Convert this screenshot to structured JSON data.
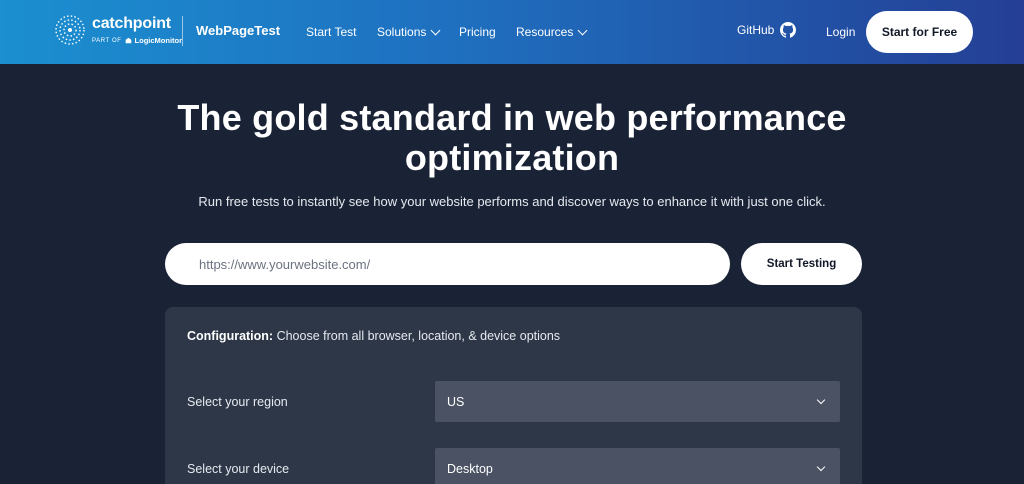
{
  "header": {
    "brand_name": "catchpoint",
    "brand_sub_prefix": "PART OF",
    "brand_sub_company": "LogicMonitor",
    "product": "WebPageTest",
    "nav": [
      {
        "label": "Start Test",
        "has_dropdown": false
      },
      {
        "label": "Solutions",
        "has_dropdown": true
      },
      {
        "label": "Pricing",
        "has_dropdown": false
      },
      {
        "label": "Resources",
        "has_dropdown": true
      }
    ],
    "github_label": "GitHub",
    "login_label": "Login",
    "cta_label": "Start for Free"
  },
  "hero": {
    "title_line1": "The gold standard in web performance",
    "title_line2": "optimization",
    "subtitle": "Run free tests to instantly see how your website performs and discover ways to enhance it with just one click."
  },
  "test_form": {
    "url_placeholder": "https://www.yourwebsite.com/",
    "url_value": "",
    "submit_label": "Start Testing"
  },
  "config": {
    "heading_bold": "Configuration:",
    "heading_text": " Choose from all browser, location, & device options",
    "fields": [
      {
        "label": "Select your region",
        "value": "US"
      },
      {
        "label": "Select your device",
        "value": "Desktop"
      }
    ]
  },
  "colors": {
    "header_gradient_start": "#1b8fd0",
    "header_gradient_end": "#243f95",
    "page_background": "#1a2336",
    "panel_background": "#2e3748",
    "select_background": "#4a5263"
  },
  "icons": [
    "catchpoint-logo-icon",
    "logicmonitor-logo-icon",
    "chevron-down-icon",
    "github-icon"
  ]
}
